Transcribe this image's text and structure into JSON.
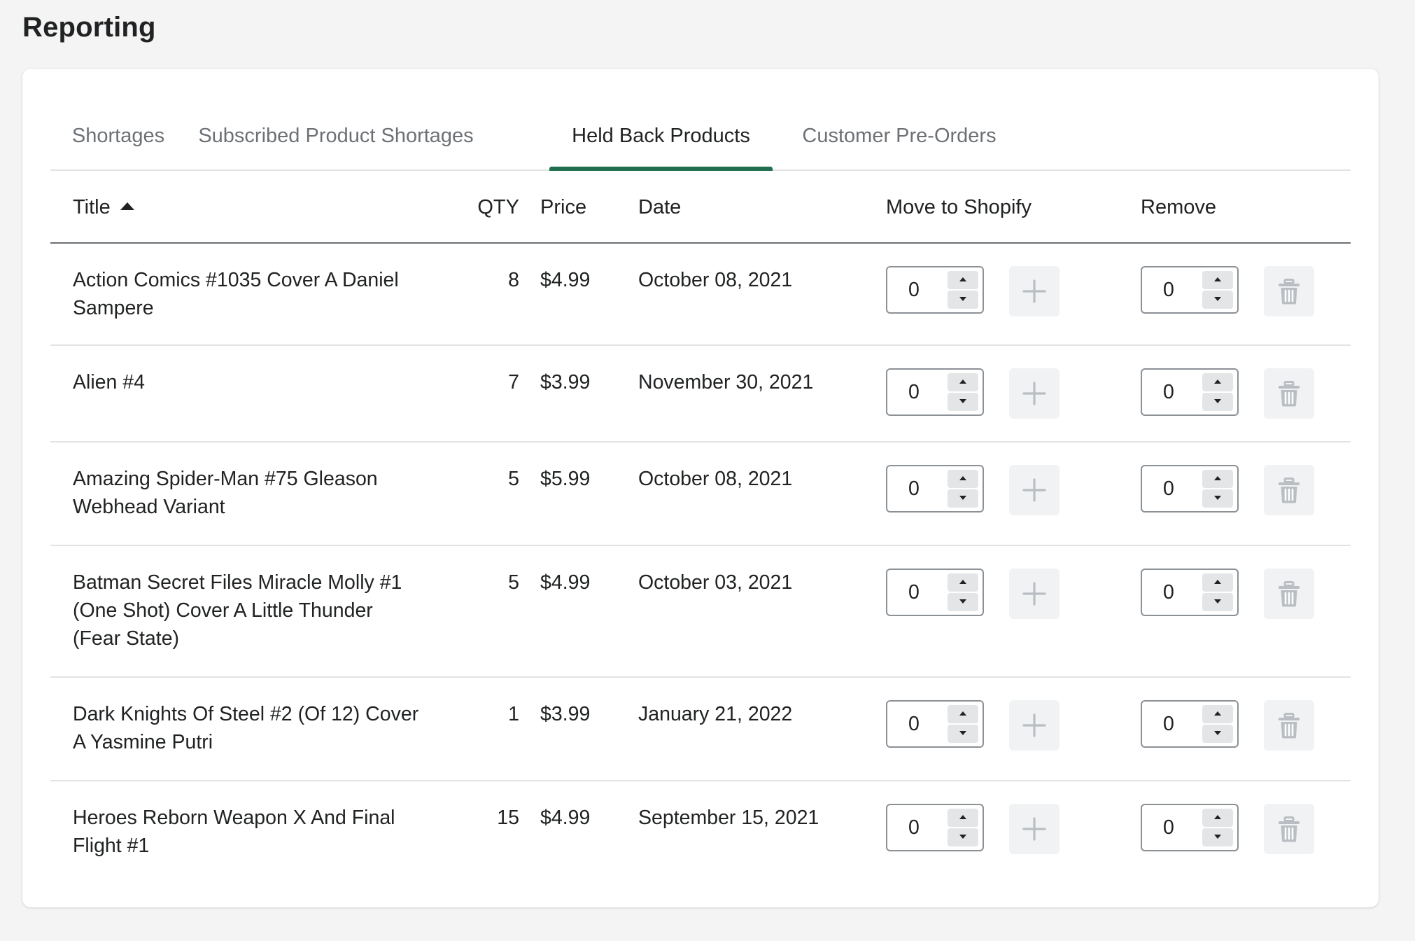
{
  "page": {
    "title": "Reporting"
  },
  "tabs": [
    {
      "label": "Shortages",
      "active": false
    },
    {
      "label": "Subscribed Product Shortages",
      "active": false
    },
    {
      "label": "Held Back Products",
      "active": true
    },
    {
      "label": "Customer Pre-Orders",
      "active": false
    }
  ],
  "table": {
    "columns": {
      "title": "Title",
      "qty": "QTY",
      "price": "Price",
      "date": "Date",
      "move": "Move to Shopify",
      "remove": "Remove"
    },
    "sort": {
      "column": "title",
      "direction": "ascending"
    },
    "rows": [
      {
        "title": "Action Comics #1035 Cover A Daniel Sampere",
        "qty": "8",
        "price": "$4.99",
        "date": "October 08, 2021",
        "move_value": "0",
        "remove_value": "0"
      },
      {
        "title": "Alien #4",
        "qty": "7",
        "price": "$3.99",
        "date": "November 30, 2021",
        "move_value": "0",
        "remove_value": "0"
      },
      {
        "title": "Amazing Spider-Man #75 Gleason Webhead Variant",
        "qty": "5",
        "price": "$5.99",
        "date": "October 08, 2021",
        "move_value": "0",
        "remove_value": "0"
      },
      {
        "title": "Batman Secret Files Miracle Molly #1 (One Shot) Cover A Little Thunder (Fear State)",
        "qty": "5",
        "price": "$4.99",
        "date": "October 03, 2021",
        "move_value": "0",
        "remove_value": "0"
      },
      {
        "title": "Dark Knights Of Steel #2 (Of 12) Cover A Yasmine Putri",
        "qty": "1",
        "price": "$3.99",
        "date": "January 21, 2022",
        "move_value": "0",
        "remove_value": "0"
      },
      {
        "title": "Heroes Reborn Weapon X And Final Flight #1",
        "qty": "15",
        "price": "$4.99",
        "date": "September 15, 2021",
        "move_value": "0",
        "remove_value": "0"
      }
    ]
  },
  "icons": {
    "sort": "caret-up-icon",
    "move": "plus-icon",
    "remove": "trash-icon",
    "spin_up": "caret-up-icon",
    "spin_down": "caret-down-icon"
  },
  "colors": {
    "active_tab_indicator": "#1f6f4f",
    "background": "#f4f4f4",
    "card": "#ffffff",
    "button_bg": "#f1f2f3",
    "icon_disabled": "#babec3"
  }
}
